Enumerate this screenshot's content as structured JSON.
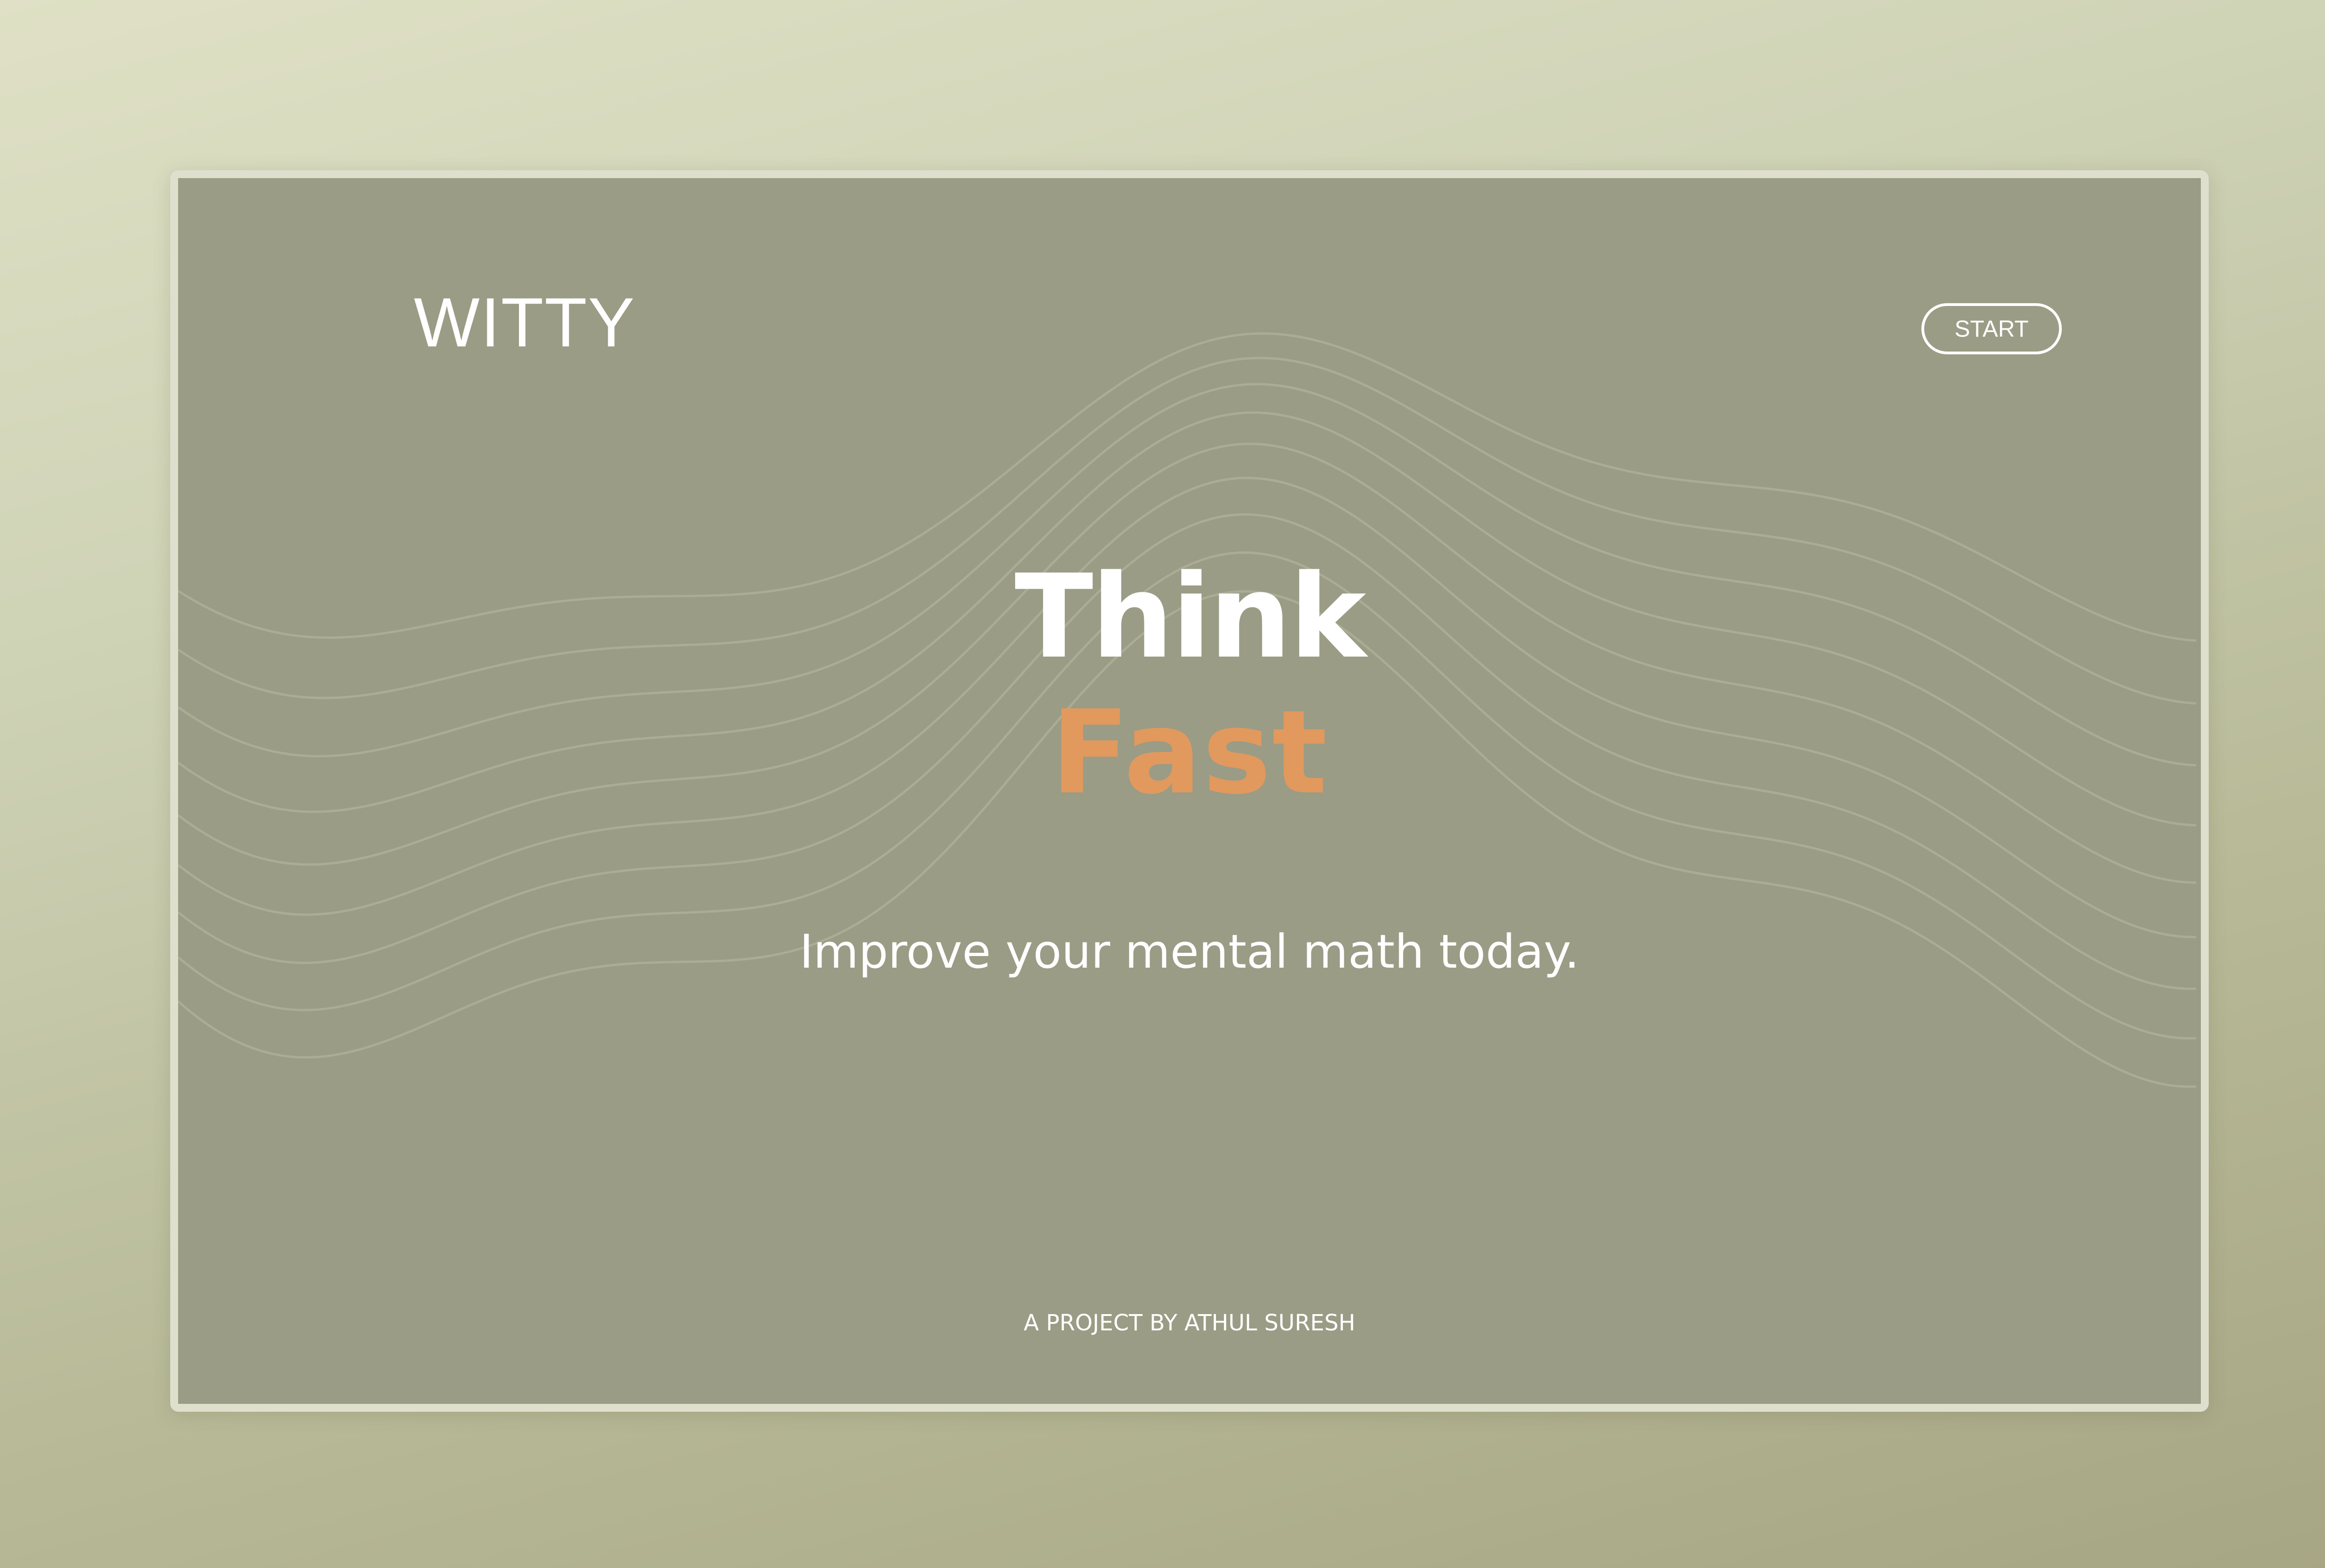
{
  "header": {
    "logo": "WITTY",
    "start_label": "START"
  },
  "hero": {
    "line1": "Think",
    "line2": "Fast",
    "tagline": "Improve your mental math today."
  },
  "footer": {
    "credit": "A PROJECT BY ATHUL SURESH"
  },
  "colors": {
    "page_background_top": "#dfe0c5",
    "page_background_bottom": "#a7a684",
    "panel": "#9a9c85",
    "panel_border": "#dedfcd",
    "accent": "#e1995e",
    "text": "#ffffff"
  },
  "decoration": {
    "background_pattern": "wave-lines"
  }
}
